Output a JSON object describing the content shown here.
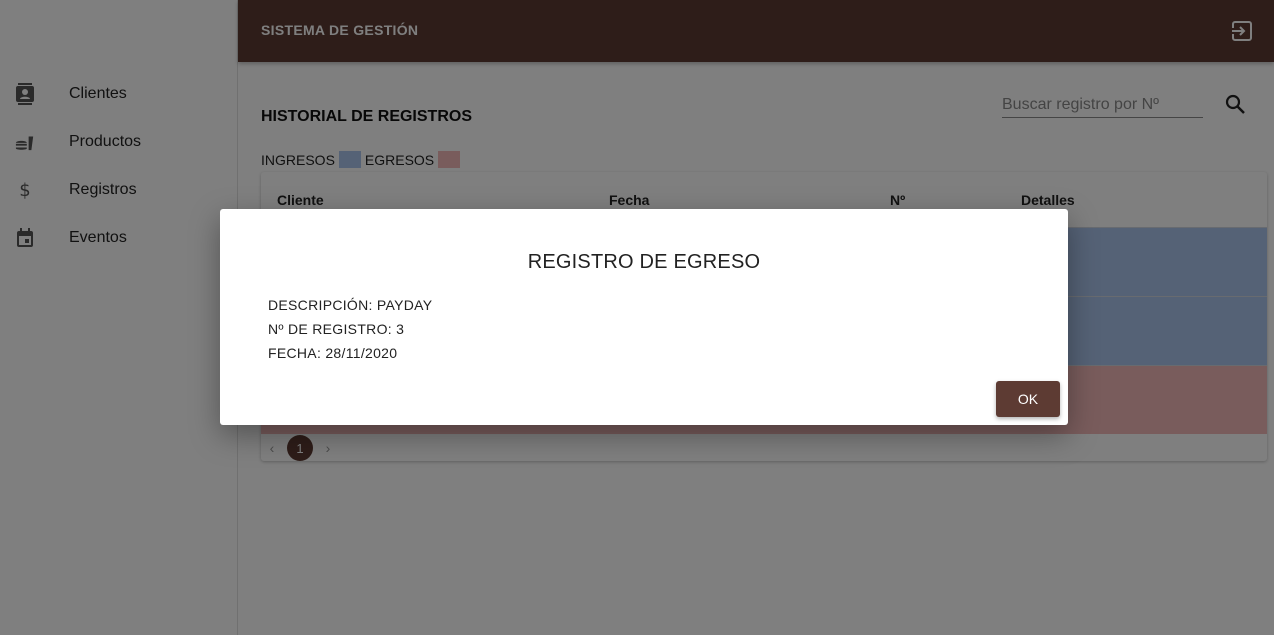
{
  "app": {
    "title": "SISTEMA DE GESTIÓN"
  },
  "sidebar": {
    "items": [
      {
        "label": "Clientes",
        "icon": "contacts-icon"
      },
      {
        "label": "Productos",
        "icon": "fastfood-icon"
      },
      {
        "label": "Registros",
        "icon": "dollar-icon"
      },
      {
        "label": "Eventos",
        "icon": "calendar-icon"
      }
    ]
  },
  "main": {
    "title": "HISTORIAL DE REGISTROS",
    "search_placeholder": "Buscar registro por Nº",
    "legend": {
      "ingresos_label": "INGRESOS",
      "egresos_label": "EGRESOS",
      "ingresos_color": "#aac4ec",
      "egresos_color": "#f2b8b8"
    },
    "table": {
      "columns": [
        "Cliente",
        "Fecha",
        "Nº",
        "Detalles"
      ],
      "row_types": [
        "ingreso",
        "ingreso",
        "egreso"
      ]
    },
    "pagination": {
      "current_page": "1"
    }
  },
  "dialog": {
    "title": "REGISTRO DE EGRESO",
    "descripcion": "DESCRIPCIÓN: PAYDAY",
    "numero": "Nº DE REGISTRO: 3",
    "fecha": "FECHA: 28/11/2020",
    "ok_label": "OK"
  },
  "colors": {
    "brand": "#5d3b33",
    "overlay": "rgba(0,0,0,0.5)"
  }
}
